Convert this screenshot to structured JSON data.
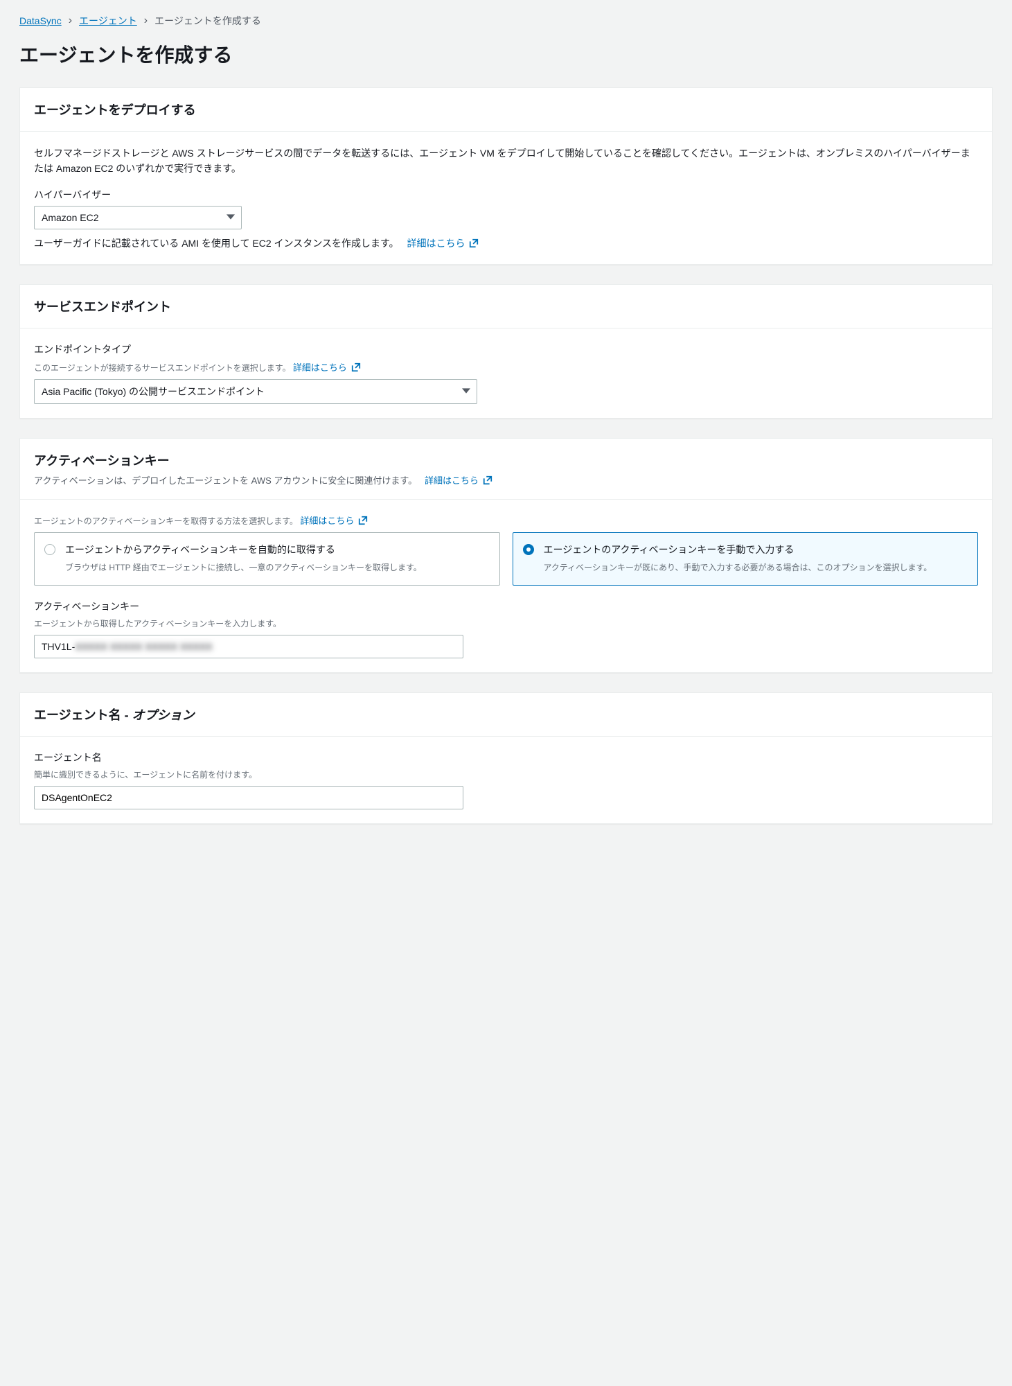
{
  "breadcrumb": {
    "root": "DataSync",
    "agents": "エージェント",
    "current": "エージェントを作成する"
  },
  "page_title": "エージェントを作成する",
  "learn_more_label": "詳細はこちら",
  "deploy": {
    "header": "エージェントをデプロイする",
    "desc": "セルフマネージドストレージと AWS ストレージサービスの間でデータを転送するには、エージェント VM をデプロイして開始していることを確認してください。エージェントは、オンプレミスのハイパーバイザーまたは Amazon EC2 のいずれかで実行できます。",
    "hypervisor_label": "ハイパーバイザー",
    "hypervisor_value": "Amazon EC2",
    "below_text": "ユーザーガイドに記載されている AMI を使用して EC2 インスタンスを作成します。"
  },
  "endpoint": {
    "header": "サービスエンドポイント",
    "type_label": "エンドポイントタイプ",
    "type_hint": "このエージェントが接続するサービスエンドポイントを選択します。",
    "value": "Asia Pacific (Tokyo) の公開サービスエンドポイント"
  },
  "activation": {
    "header": "アクティベーションキー",
    "sub": "アクティベーションは、デプロイしたエージェントを AWS アカウントに安全に関連付けます。",
    "method_hint": "エージェントのアクティベーションキーを取得する方法を選択します。",
    "option_auto_title": "エージェントからアクティベーションキーを自動的に取得する",
    "option_auto_desc": "ブラウザは HTTP 経由でエージェントに接続し、一意のアクティベーションキーを取得します。",
    "option_manual_title": "エージェントのアクティベーションキーを手動で入力する",
    "option_manual_desc": "アクティベーションキーが既にあり、手動で入力する必要がある場合は、このオプションを選択します。",
    "key_label": "アクティベーションキー",
    "key_hint": "エージェントから取得したアクティベーションキーを入力します。",
    "key_value_prefix": "THV1L-",
    "key_value_hidden": "XXXXX XXXXX XXXXX XXXXX"
  },
  "agent_name": {
    "header_main": "エージェント名 - ",
    "header_suffix": "オプション",
    "label": "エージェント名",
    "hint": "簡単に識別できるように、エージェントに名前を付けます。",
    "value": "DSAgentOnEC2"
  }
}
